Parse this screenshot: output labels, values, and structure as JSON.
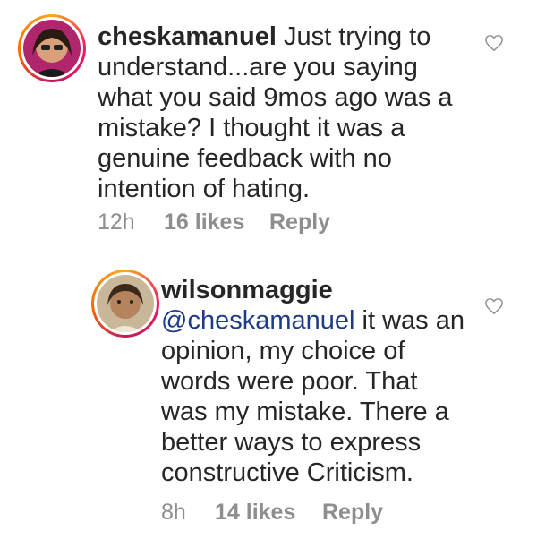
{
  "comments": [
    {
      "username": "cheskamanuel",
      "text": "Just trying to understand...are you saying what you said 9mos ago was a mistake? I thought it was a genuine feedback with no intention of hating.",
      "time": "12h",
      "likes": "16 likes",
      "reply": "Reply",
      "avatar_icon": "profile-photo"
    },
    {
      "username": "wilsonmaggie",
      "mention": "@cheskamanuel",
      "text": "it was an opinion, my choice of words were poor. That was my mistake. There a better ways to express constructive Criticism.",
      "time": "8h",
      "likes": "14 likes",
      "reply": "Reply",
      "avatar_icon": "profile-photo"
    }
  ],
  "icons": {
    "like": "heart-outline-icon"
  },
  "colors": {
    "username": "#262626",
    "meta": "#8e8e8e",
    "mention": "#1e3a8a"
  }
}
